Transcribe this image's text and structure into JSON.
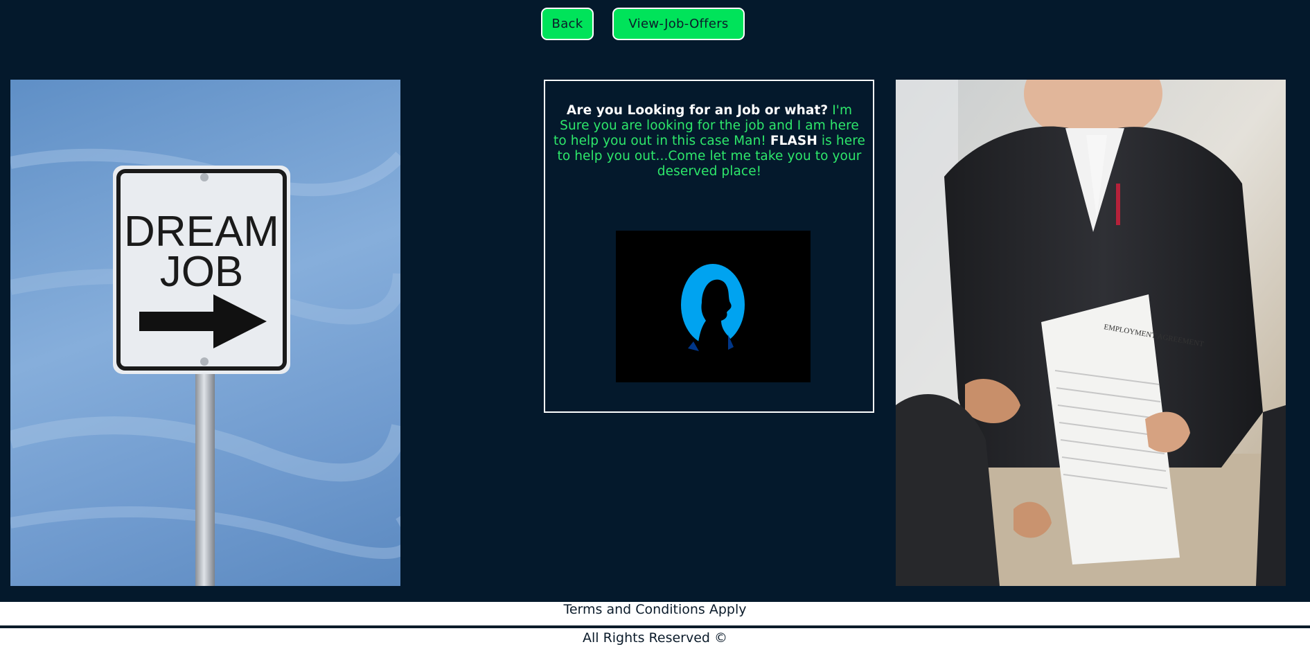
{
  "nav": {
    "back_label": "Back",
    "offers_label": "View-Job-Offers"
  },
  "card": {
    "question": "Are you Looking for an Job or what?",
    "text_part1": " I'm Sure you are looking for the job and I am here to help you out in this case Man! ",
    "brand": "FLASH",
    "text_part2": " is here to help you out...Come let me take you to your deserved place!"
  },
  "sign": {
    "line1": "DREAM",
    "line2": "JOB"
  },
  "document": {
    "heading": "EMPLOYMENT AGREEMENT"
  },
  "footer": {
    "terms": "Terms and Conditions Apply",
    "rights": "All Rights Reserved ©"
  },
  "colors": {
    "background": "#04192c",
    "accent_green": "#00e35a",
    "text_green": "#2ee86b",
    "avatar_blue": "#00a3f0"
  },
  "icons": {
    "avatar": "person-silhouette-icon",
    "arrow": "right-arrow-icon"
  }
}
